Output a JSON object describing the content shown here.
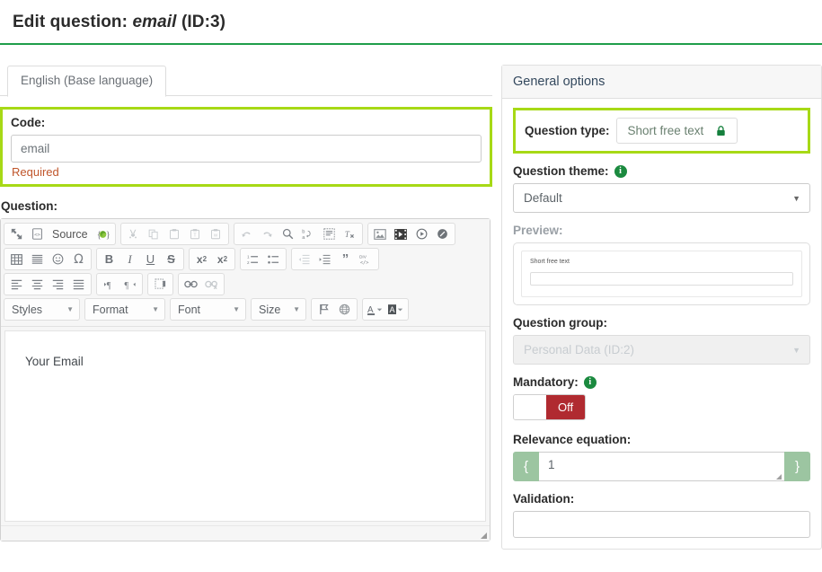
{
  "header": {
    "title_prefix": "Edit question:",
    "title_code": "email",
    "title_id": "(ID:3)"
  },
  "tabs": [
    {
      "label": "English (Base language)"
    }
  ],
  "left": {
    "code": {
      "label": "Code:",
      "value": "email",
      "placeholder": "",
      "required_text": "Required"
    },
    "question": {
      "label": "Question:",
      "body_text": "Your Email"
    },
    "editor": {
      "row1": {
        "group1": [
          {
            "name": "maximize-icon",
            "glyph": "maximize"
          },
          {
            "name": "source-icon",
            "glyph": "source",
            "label": "Source"
          },
          {
            "name": "expression-manager-icon",
            "glyph": "lime"
          }
        ],
        "group2": [
          {
            "name": "cut-icon",
            "glyph": "cut"
          },
          {
            "name": "copy-icon",
            "glyph": "copy"
          },
          {
            "name": "paste-icon",
            "glyph": "paste"
          },
          {
            "name": "paste-text-icon",
            "glyph": "paste-text"
          },
          {
            "name": "paste-word-icon",
            "glyph": "paste-word"
          }
        ],
        "group3": [
          {
            "name": "undo-icon",
            "glyph": "undo"
          },
          {
            "name": "redo-icon",
            "glyph": "redo"
          },
          {
            "name": "find-icon",
            "glyph": "find"
          },
          {
            "name": "replace-icon",
            "glyph": "replace"
          },
          {
            "name": "select-all-icon",
            "glyph": "select-all"
          },
          {
            "name": "remove-format-icon",
            "glyph": "remove-format"
          }
        ],
        "group4": [
          {
            "name": "image-icon",
            "glyph": "image"
          },
          {
            "name": "flash-icon",
            "glyph": "flash"
          },
          {
            "name": "media-embed-icon",
            "glyph": "media"
          },
          {
            "name": "iframe-icon",
            "glyph": "iframe"
          }
        ]
      },
      "row2": {
        "group1": [
          {
            "name": "table-icon",
            "glyph": "table"
          },
          {
            "name": "horizontal-rule-icon",
            "glyph": "hrule"
          },
          {
            "name": "smiley-icon",
            "glyph": "smiley"
          },
          {
            "name": "special-char-icon",
            "glyph": "omega"
          }
        ],
        "group2": [
          {
            "name": "bold-icon",
            "glyph": "B"
          },
          {
            "name": "italic-icon",
            "glyph": "I"
          },
          {
            "name": "underline-icon",
            "glyph": "U"
          },
          {
            "name": "strike-icon",
            "glyph": "S"
          }
        ],
        "group3": [
          {
            "name": "subscript-icon",
            "glyph": "sub"
          },
          {
            "name": "superscript-icon",
            "glyph": "sup"
          }
        ],
        "group4": [
          {
            "name": "numbered-list-icon",
            "glyph": "ol"
          },
          {
            "name": "bulleted-list-icon",
            "glyph": "ul"
          }
        ],
        "group5": [
          {
            "name": "outdent-icon",
            "glyph": "outdent"
          },
          {
            "name": "indent-icon",
            "glyph": "indent"
          },
          {
            "name": "blockquote-icon",
            "glyph": "quote"
          },
          {
            "name": "create-div-icon",
            "glyph": "div"
          }
        ]
      },
      "row3": {
        "group1": [
          {
            "name": "align-left-icon",
            "glyph": "al"
          },
          {
            "name": "align-center-icon",
            "glyph": "ac"
          },
          {
            "name": "align-right-icon",
            "glyph": "ar"
          },
          {
            "name": "align-justify-icon",
            "glyph": "aj"
          }
        ],
        "group2": [
          {
            "name": "text-direction-ltr-icon",
            "glyph": "ltr"
          },
          {
            "name": "text-direction-rtl-icon",
            "glyph": "rtl"
          }
        ],
        "group3": [
          {
            "name": "page-break-icon",
            "glyph": "pagebreak"
          }
        ],
        "group4": [
          {
            "name": "link-icon",
            "glyph": "link"
          },
          {
            "name": "unlink-icon",
            "glyph": "unlink"
          }
        ]
      },
      "row4": {
        "combos": [
          {
            "name": "styles-combo",
            "label": "Styles"
          },
          {
            "name": "format-combo",
            "label": "Format"
          },
          {
            "name": "font-combo",
            "label": "Font"
          },
          {
            "name": "size-combo",
            "label": "Size"
          }
        ],
        "group_flags": [
          {
            "name": "flag-icon",
            "glyph": "flag"
          },
          {
            "name": "globe-icon",
            "glyph": "globe"
          }
        ],
        "group_colors": [
          {
            "name": "text-color-icon",
            "glyph": "textcolor"
          },
          {
            "name": "background-color-icon",
            "glyph": "bgcolor"
          }
        ]
      }
    }
  },
  "right": {
    "panel_title": "General options",
    "question_type": {
      "label": "Question type:",
      "value": "Short free text",
      "lock_icon": "lock-icon"
    },
    "question_theme": {
      "label": "Question theme:",
      "info_icon": "info-icon",
      "value": "Default"
    },
    "preview": {
      "label": "Preview:",
      "question_text": "Short free text"
    },
    "question_group": {
      "label": "Question group:",
      "value": "Personal Data (ID:2)"
    },
    "mandatory": {
      "label": "Mandatory:",
      "info_icon": "info-icon",
      "state_label": "Off"
    },
    "relevance": {
      "label": "Relevance equation:",
      "brace_open": "{",
      "brace_close": "}",
      "value": "1"
    },
    "validation": {
      "label": "Validation:",
      "value": ""
    }
  },
  "colors": {
    "accent_green": "#1f9e4a",
    "highlight": "#a7d916",
    "danger": "#b02a30",
    "addon_green": "#9cc5a1",
    "required_text": "#c0562b"
  }
}
